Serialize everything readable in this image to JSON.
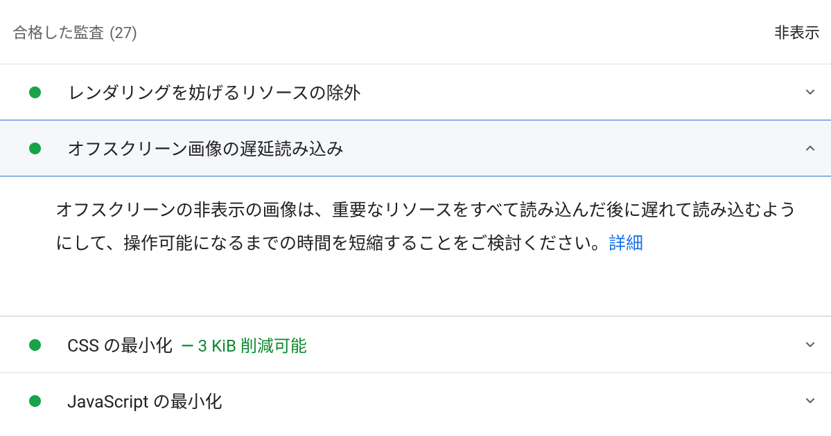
{
  "header": {
    "title": "合格した監査",
    "count": "(27)",
    "toggle_label": "非表示"
  },
  "audits": [
    {
      "title": "レンダリングを妨げるリソースの除外",
      "expanded": false,
      "detail": ""
    },
    {
      "title": "オフスクリーン画像の遅延読み込み",
      "expanded": true,
      "detail": "",
      "description": "オフスクリーンの非表示の画像は、重要なリソースをすべて読み込んだ後に遅れて読み込むようにして、操作可能になるまでの時間を短縮することをご検討ください。",
      "learn_more": "詳細"
    },
    {
      "title": "CSS の最小化",
      "expanded": false,
      "detail": "3 KiB 削減可能"
    },
    {
      "title": "JavaScript の最小化",
      "expanded": false,
      "detail": ""
    }
  ],
  "colors": {
    "pass": "#16a34a",
    "link": "#1a73e8",
    "highlight_border": "#2a6ed4"
  }
}
